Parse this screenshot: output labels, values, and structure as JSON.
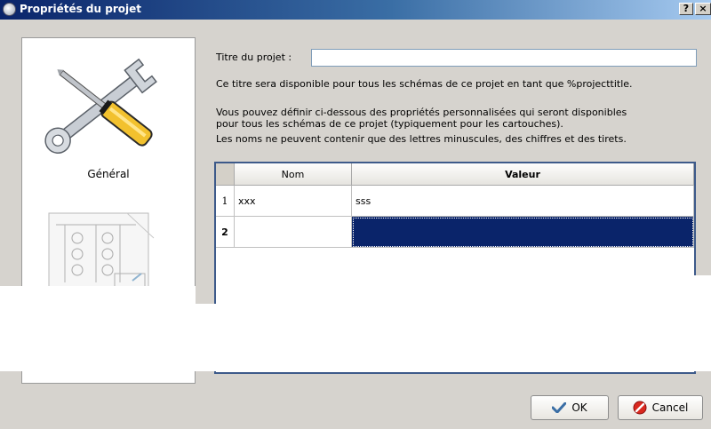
{
  "window": {
    "title": "Propriétés du projet",
    "help_label": "?",
    "close_label": "×"
  },
  "sidebar": {
    "items": [
      {
        "label": "Général",
        "icon": "tools-icon"
      },
      {
        "label": "",
        "icon": "schema-icon"
      }
    ]
  },
  "form": {
    "title_label": "Titre du projet :",
    "title_value": "",
    "info_title": "Ce titre sera disponible pour tous les schémas de ce projet en tant que %projecttitle.",
    "info_custom_1": "Vous pouvez définir ci-dessous des propriétés personnalisées qui seront disponibles",
    "info_custom_2": "pour tous les schémas de ce projet (typiquement pour les cartouches).",
    "info_names": "Les noms ne peuvent contenir que des lettres minuscules, des chiffres et des tirets."
  },
  "table": {
    "columns": [
      "Nom",
      "Valeur"
    ],
    "rows": [
      {
        "num": "1",
        "name": "xxx",
        "value": "sss"
      },
      {
        "num": "2",
        "name": "",
        "value": ""
      }
    ]
  },
  "buttons": {
    "ok": "OK",
    "cancel": "Cancel"
  },
  "colors": {
    "selection": "#0a246a",
    "titlebar": "#0a246a",
    "dialog_bg": "#d6d3ce"
  }
}
